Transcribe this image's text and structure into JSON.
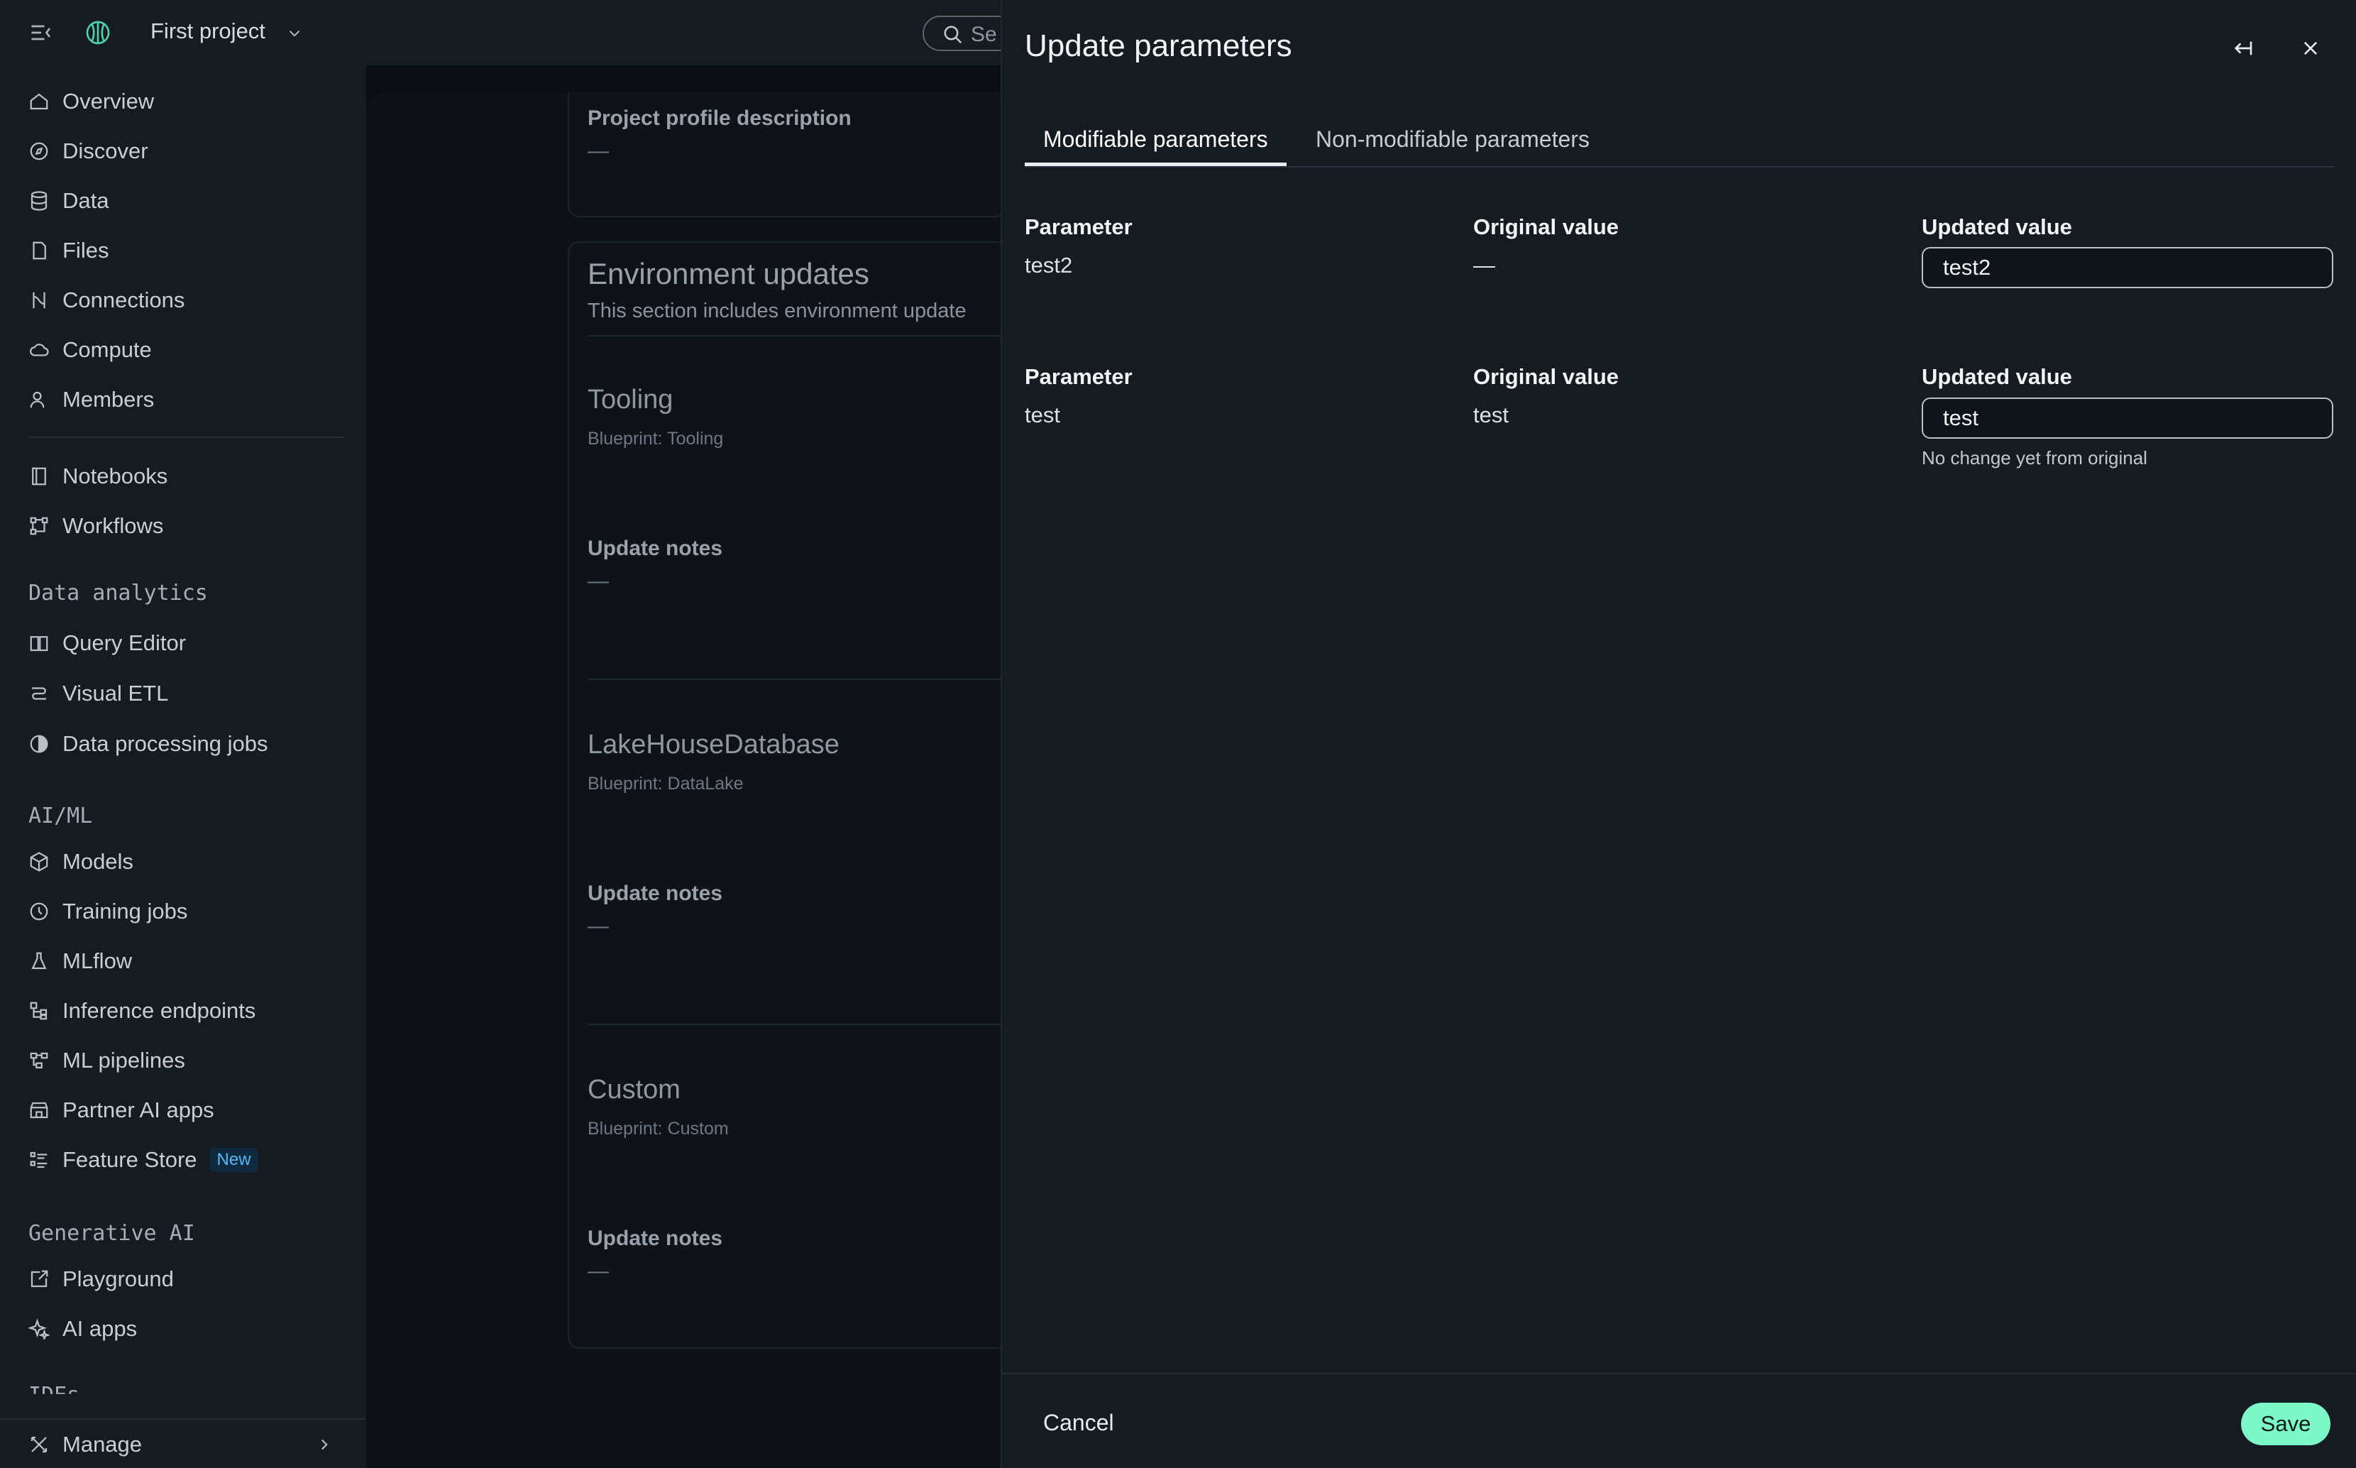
{
  "topbar": {
    "project_name": "First project",
    "search_placeholder": "Se"
  },
  "sidebar": {
    "group1": [
      {
        "label": "Overview",
        "icon": "home-icon"
      },
      {
        "label": "Discover",
        "icon": "compass-icon"
      },
      {
        "label": "Data",
        "icon": "database-icon"
      },
      {
        "label": "Files",
        "icon": "file-icon"
      },
      {
        "label": "Connections",
        "icon": "connections-icon"
      },
      {
        "label": "Compute",
        "icon": "cloud-icon"
      },
      {
        "label": "Members",
        "icon": "members-icon"
      }
    ],
    "group2": [
      {
        "label": "Notebooks",
        "icon": "notebook-icon"
      },
      {
        "label": "Workflows",
        "icon": "workflow-icon"
      }
    ],
    "data_analytics_label": "Data analytics",
    "data_analytics": [
      {
        "label": "Query Editor",
        "icon": "book-icon"
      },
      {
        "label": "Visual ETL",
        "icon": "etl-icon"
      },
      {
        "label": "Data processing jobs",
        "icon": "processing-icon"
      }
    ],
    "aiml_label": "AI/ML",
    "aiml": [
      {
        "label": "Models",
        "icon": "cube-icon"
      },
      {
        "label": "Training jobs",
        "icon": "clock-icon"
      },
      {
        "label": "MLflow",
        "icon": "flask-icon"
      },
      {
        "label": "Inference endpoints",
        "icon": "endpoints-icon"
      },
      {
        "label": "ML pipelines",
        "icon": "pipeline-icon"
      },
      {
        "label": "Partner AI apps",
        "icon": "store-icon"
      },
      {
        "label": "Feature Store",
        "icon": "list-icon",
        "badge": "New"
      }
    ],
    "genai_label": "Generative AI",
    "genai": [
      {
        "label": "Playground",
        "icon": "playground-icon"
      },
      {
        "label": "AI apps",
        "icon": "sparkle-icon"
      }
    ],
    "ides_label": "IDEs",
    "manage_label": "Manage"
  },
  "main": {
    "profile_description_label": "Project profile description",
    "profile_description_value": "—",
    "env_title": "Environment updates",
    "env_subtitle": "This section includes environment update",
    "blocks": [
      {
        "title": "Tooling",
        "blueprint": "Blueprint: Tooling",
        "notes_label": "Update notes",
        "notes_value": "—"
      },
      {
        "title": "LakeHouseDatabase",
        "blueprint": "Blueprint: DataLake",
        "notes_label": "Update notes",
        "notes_value": "—"
      },
      {
        "title": "Custom",
        "blueprint": "Blueprint: Custom",
        "notes_label": "Update notes",
        "notes_value": "—"
      }
    ]
  },
  "panel": {
    "title": "Update parameters",
    "tabs": [
      {
        "label": "Modifiable parameters",
        "active": true
      },
      {
        "label": "Non-modifiable parameters",
        "active": false
      }
    ],
    "column_labels": {
      "parameter": "Parameter",
      "original": "Original value",
      "updated": "Updated value"
    },
    "rows": [
      {
        "parameter": "test2",
        "original": "—",
        "updated": "test2",
        "hint": ""
      },
      {
        "parameter": "test",
        "original": "test",
        "updated": "test",
        "hint": "No change yet from original"
      }
    ],
    "cancel_label": "Cancel",
    "save_label": "Save",
    "accent_color": "#7cf7c8"
  }
}
